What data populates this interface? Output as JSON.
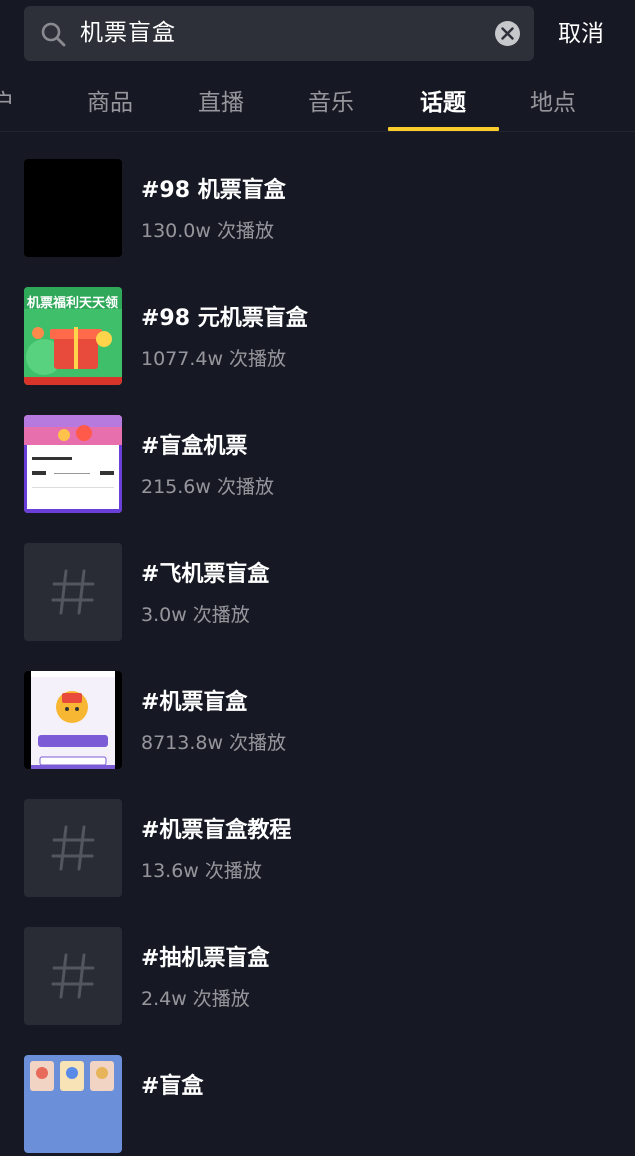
{
  "search": {
    "query": "机票盲盒",
    "cancel_label": "取消"
  },
  "tabs": [
    {
      "label": "户"
    },
    {
      "label": "商品"
    },
    {
      "label": "直播"
    },
    {
      "label": "音乐"
    },
    {
      "label": "话题",
      "active": true
    },
    {
      "label": "地点"
    }
  ],
  "results": [
    {
      "title": "#98 机票盲盒",
      "plays": "130.0w 次播放",
      "thumb": "black"
    },
    {
      "title": "#98 元机票盲盒",
      "plays": "1077.4w 次播放",
      "thumb": "promo-green",
      "thumb_text": "机票福利天天领"
    },
    {
      "title": "#盲盒机票",
      "plays": "215.6w 次播放",
      "thumb": "ticket-screenshot"
    },
    {
      "title": "#飞机票盲盒",
      "plays": "3.0w 次播放",
      "thumb": "hashtag"
    },
    {
      "title": "#机票盲盒",
      "plays": "8713.8w 次播放",
      "thumb": "app-screenshot"
    },
    {
      "title": "#机票盲盒教程",
      "plays": "13.6w 次播放",
      "thumb": "hashtag"
    },
    {
      "title": "#抽机票盲盒",
      "plays": "2.4w 次播放",
      "thumb": "hashtag"
    },
    {
      "title": "#盲盒",
      "plays": "",
      "thumb": "game-screenshot"
    }
  ],
  "colors": {
    "background": "#161823",
    "search_box": "#2e3039",
    "accent_underline": "#facd2c",
    "hashtag_tile": "#2a2c35"
  }
}
